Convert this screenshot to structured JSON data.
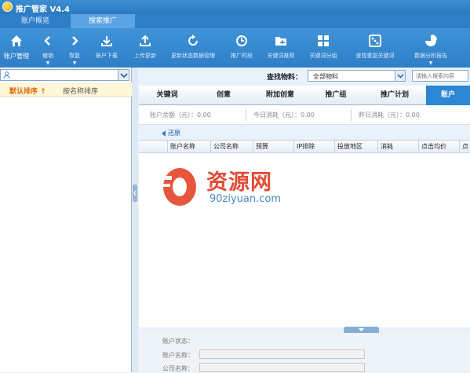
{
  "app": {
    "title": "推广管家 V4.4"
  },
  "top_tabs": [
    {
      "label": "账户概览"
    },
    {
      "label": "搜索推广"
    }
  ],
  "toolbar": [
    {
      "label": "账户管理",
      "icon": "home-icon"
    },
    {
      "label": "撤销",
      "icon": "undo-icon"
    },
    {
      "label": "恢复",
      "icon": "redo-icon"
    },
    {
      "label": "账户下载",
      "icon": "download-icon"
    },
    {
      "label": "上传更新",
      "icon": "upload-icon"
    },
    {
      "label": "更新状态数据管理",
      "icon": "refresh-icon"
    },
    {
      "label": "推广时段",
      "icon": "clock-icon"
    },
    {
      "label": "关键词推荐",
      "icon": "folder-icon"
    },
    {
      "label": "关键词分组",
      "icon": "grid-icon"
    },
    {
      "label": "查找重复关键词",
      "icon": "dice-icon"
    },
    {
      "label": "数据分析报告",
      "icon": "pie-chart-icon"
    }
  ],
  "sidebar": {
    "sort_default": "默认排序 ↑",
    "sort_name": "按名称排序"
  },
  "filter": {
    "label": "查找物料：",
    "selected": "全部物料",
    "search_placeholder": "请输入搜索内容"
  },
  "main_tabs": [
    {
      "label": "关键词"
    },
    {
      "label": "创意"
    },
    {
      "label": "附加创意"
    },
    {
      "label": "推广组"
    },
    {
      "label": "推广计划"
    },
    {
      "label": "账户"
    }
  ],
  "stats": [
    {
      "label": "账户余额（元）：",
      "value": "0.00"
    },
    {
      "label": "今日消耗（元）：",
      "value": "0.00"
    },
    {
      "label": "昨日消耗（元）：",
      "value": "0.00"
    }
  ],
  "restore_label": "还原",
  "grid": {
    "columns": [
      "",
      "账户名称",
      "公司名称",
      "预算",
      "IP排除",
      "投放地区",
      "消耗",
      "点击均价",
      "点"
    ]
  },
  "detail": {
    "fields": [
      {
        "label": "账户状态："
      },
      {
        "label": "账户名称："
      },
      {
        "label": "公司名称："
      }
    ]
  },
  "watermark": {
    "text": "资源网",
    "url": "90ziyuan.com"
  }
}
